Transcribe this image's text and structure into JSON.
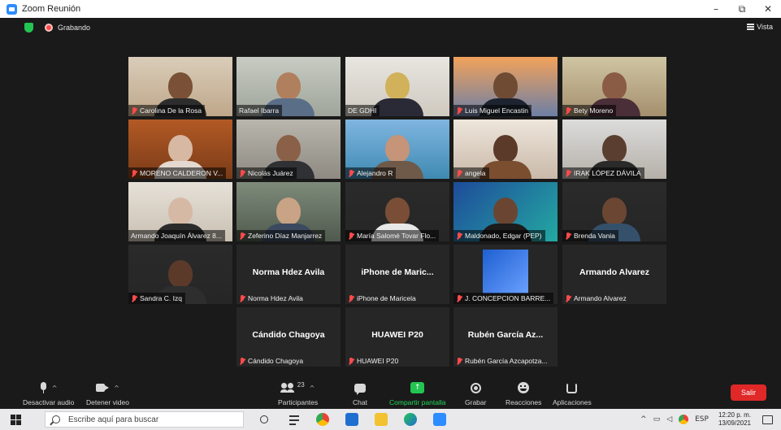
{
  "window": {
    "title": "Zoom Reunión",
    "controls": [
      "–",
      "⧉",
      "✕"
    ]
  },
  "meeting": {
    "recording_label": "Grabando",
    "view_label": "Vista"
  },
  "participants": [
    {
      "name": "Carolina De la Rosa",
      "muted": true,
      "video": true
    },
    {
      "name": "Rafael Ibarra",
      "muted": false,
      "video": true,
      "active_speaker": true
    },
    {
      "name": "DE GDHI",
      "muted": false,
      "video": true
    },
    {
      "name": "Luis Miguel Encastin",
      "muted": true,
      "video": true
    },
    {
      "name": "Bety Moreno",
      "muted": true,
      "video": true
    },
    {
      "name": "MORENO CALDERON V...",
      "muted": true,
      "video": true
    },
    {
      "name": "Nicolás Juárez",
      "muted": true,
      "video": true
    },
    {
      "name": "Alejandro R",
      "muted": true,
      "video": true
    },
    {
      "name": "angela",
      "muted": true,
      "video": true
    },
    {
      "name": "IRAK LÓPEZ DÁVILA",
      "muted": true,
      "video": true
    },
    {
      "name": "Armando Joaquín Álvarez 8...",
      "muted": false,
      "video": true
    },
    {
      "name": "Zeferino Díaz Manjarrez",
      "muted": true,
      "video": true
    },
    {
      "name": "María Salomé Tovar Flo...",
      "muted": true,
      "video": true
    },
    {
      "name": "Maldonado, Edgar (PEP)",
      "muted": true,
      "video": true
    },
    {
      "name": "Brenda Vania",
      "muted": true,
      "video": true
    },
    {
      "name": "Sandra C. Izq",
      "muted": true,
      "video": true
    },
    {
      "name": "Norma Hdez Avila",
      "display": "Norma Hdez Avila",
      "muted": true,
      "video": false
    },
    {
      "name": "iPhone de Maricela",
      "display": "iPhone de Maric...",
      "muted": true,
      "video": false
    },
    {
      "name": "J. CONCEPCION BARRE...",
      "muted": true,
      "video": true
    },
    {
      "name": "Armando Alvarez",
      "display": "Armando Alvarez",
      "muted": true,
      "video": false
    },
    {
      "name": "Cándido Chagoya",
      "display": "Cándido Chagoya",
      "muted": true,
      "video": false
    },
    {
      "name": "HUAWEI P20",
      "display": "HUAWEI P20",
      "muted": true,
      "video": false
    },
    {
      "name": "Rubén García Azcapotza...",
      "display": "Rubén García Az...",
      "muted": true,
      "video": false
    }
  ],
  "toolbar": {
    "mute_label": "Desactivar audio",
    "video_label": "Detener video",
    "participants_label": "Participantes",
    "participants_count": "23",
    "chat_label": "Chat",
    "share_label": "Compartir pantalla",
    "record_label": "Grabar",
    "reactions_label": "Reacciones",
    "apps_label": "Aplicaciones",
    "leave_label": "Salir"
  },
  "taskbar": {
    "search_placeholder": "Escribe aquí para buscar",
    "language": "ESP",
    "time": "12:20 p. m.",
    "date": "13/09/2021"
  },
  "colors": {
    "active_speaker": "#c2e67a",
    "share_green": "#23c552",
    "leave_red": "#e02828",
    "muted_red": "#ff4a4a"
  }
}
